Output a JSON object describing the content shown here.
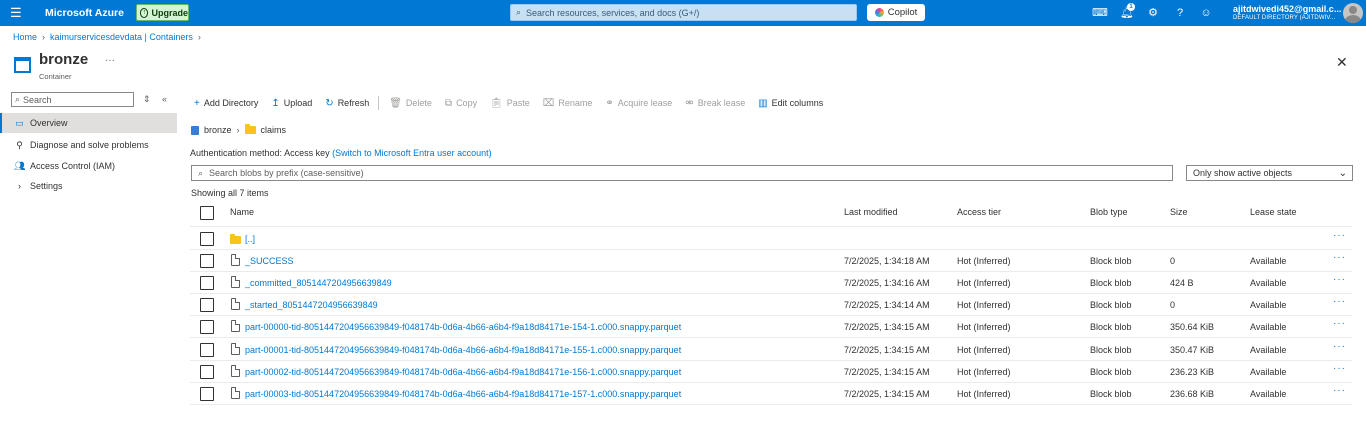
{
  "topbar": {
    "brand": "Microsoft Azure",
    "upgrade_label": "Upgrade",
    "search_placeholder": "Search resources, services, and docs (G+/)",
    "copilot_label": "Copilot",
    "notification_count": "1",
    "user_email": "ajitdwivedi452@gmail.c...",
    "user_directory": "DEFAULT DIRECTORY (AJITDWIV...",
    "accent_color": "#0078d4"
  },
  "breadcrumb": {
    "items": [
      "Home",
      "kaimurservicesdevdata | Containers"
    ]
  },
  "page": {
    "title": "bronze",
    "subtitle": "Container",
    "more": "···"
  },
  "sidebar": {
    "search_placeholder": "Search",
    "items": [
      {
        "label": "Overview",
        "icon": "overview-icon",
        "active": true
      },
      {
        "label": "Diagnose and solve problems",
        "icon": "wrench-icon"
      },
      {
        "label": "Access Control (IAM)",
        "icon": "people-icon"
      },
      {
        "label": "Settings",
        "icon": "chevron-right-icon"
      }
    ]
  },
  "toolbar": {
    "add_directory": "Add Directory",
    "upload": "Upload",
    "refresh": "Refresh",
    "delete": "Delete",
    "copy": "Copy",
    "paste": "Paste",
    "rename": "Rename",
    "acquire_lease": "Acquire lease",
    "break_lease": "Break lease",
    "edit_columns": "Edit columns"
  },
  "path": {
    "container": "bronze",
    "folder": "claims"
  },
  "auth": {
    "label": "Authentication method:",
    "value": "Access key",
    "switch_link": "(Switch to Microsoft Entra user account)"
  },
  "blob_search": {
    "placeholder": "Search blobs by prefix (case-sensitive)"
  },
  "filter": {
    "selected": "Only show active objects"
  },
  "showing": "Showing all 7 items",
  "table": {
    "headers": {
      "name": "Name",
      "last_modified": "Last modified",
      "access_tier": "Access tier",
      "blob_type": "Blob type",
      "size": "Size",
      "lease_state": "Lease state"
    },
    "parent_row": {
      "name": "[..]"
    },
    "rows": [
      {
        "name": "_SUCCESS",
        "modified": "7/2/2025, 1:34:18 AM",
        "tier": "Hot (Inferred)",
        "type": "Block blob",
        "size": "0",
        "lease": "Available"
      },
      {
        "name": "_committed_8051447204956639849",
        "modified": "7/2/2025, 1:34:16 AM",
        "tier": "Hot (Inferred)",
        "type": "Block blob",
        "size": "424 B",
        "lease": "Available"
      },
      {
        "name": "_started_8051447204956639849",
        "modified": "7/2/2025, 1:34:14 AM",
        "tier": "Hot (Inferred)",
        "type": "Block blob",
        "size": "0",
        "lease": "Available"
      },
      {
        "name": "part-00000-tid-8051447204956639849-f048174b-0d6a-4b66-a6b4-f9a18d84171e-154-1.c000.snappy.parquet",
        "modified": "7/2/2025, 1:34:15 AM",
        "tier": "Hot (Inferred)",
        "type": "Block blob",
        "size": "350.64 KiB",
        "lease": "Available"
      },
      {
        "name": "part-00001-tid-8051447204956639849-f048174b-0d6a-4b66-a6b4-f9a18d84171e-155-1.c000.snappy.parquet",
        "modified": "7/2/2025, 1:34:15 AM",
        "tier": "Hot (Inferred)",
        "type": "Block blob",
        "size": "350.47 KiB",
        "lease": "Available"
      },
      {
        "name": "part-00002-tid-8051447204956639849-f048174b-0d6a-4b66-a6b4-f9a18d84171e-156-1.c000.snappy.parquet",
        "modified": "7/2/2025, 1:34:15 AM",
        "tier": "Hot (Inferred)",
        "type": "Block blob",
        "size": "236.23 KiB",
        "lease": "Available"
      },
      {
        "name": "part-00003-tid-8051447204956639849-f048174b-0d6a-4b66-a6b4-f9a18d84171e-157-1.c000.snappy.parquet",
        "modified": "7/2/2025, 1:34:15 AM",
        "tier": "Hot (Inferred)",
        "type": "Block blob",
        "size": "236.68 KiB",
        "lease": "Available"
      }
    ]
  }
}
